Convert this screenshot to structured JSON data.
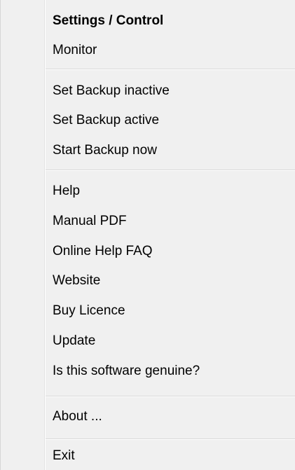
{
  "menu": {
    "items": [
      {
        "label": "Settings / Control"
      },
      {
        "label": "Monitor"
      },
      {
        "label": "Set Backup inactive"
      },
      {
        "label": "Set Backup active"
      },
      {
        "label": "Start Backup now"
      },
      {
        "label": "Help"
      },
      {
        "label": "Manual PDF"
      },
      {
        "label": "Online Help FAQ"
      },
      {
        "label": "Website"
      },
      {
        "label": "Buy Licence"
      },
      {
        "label": "Update"
      },
      {
        "label": "Is this software genuine?"
      },
      {
        "label": "About ..."
      },
      {
        "label": "Exit"
      }
    ]
  }
}
